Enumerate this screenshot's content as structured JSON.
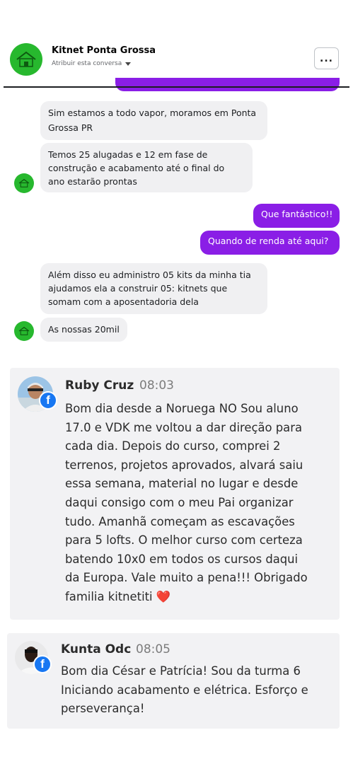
{
  "header": {
    "page_name": "Kitnet Ponta Grossa",
    "assign_label": "Atribuir esta conversa",
    "more_label": "..."
  },
  "chat": {
    "messages": [
      {
        "from": "page",
        "lines": [
          "Sim estamos a todo vapor, moramos em Ponta",
          "Grossa PR"
        ]
      },
      {
        "from": "page",
        "lines": [
          "Temos 25 alugadas e 12 em fase de",
          "construção e acabamento até o final do",
          "ano estarão prontas"
        ]
      },
      {
        "from": "user",
        "text": "Que fantástico!!"
      },
      {
        "from": "user",
        "text": "Quando de renda até aqui?"
      },
      {
        "from": "page",
        "lines": [
          "Além disso eu administro 05 kits da minha tia",
          "ajudamos ela a construir 05: kitnets que",
          "somam com a aposentadoria dela"
        ]
      },
      {
        "from": "page",
        "lines": [
          "As nossas 20mil"
        ]
      }
    ]
  },
  "comments": [
    {
      "name": "Ruby Cruz",
      "time": "08:03",
      "lines": [
        "Bom dia desde a Noruega NO Sou aluno",
        "17.0 e VDK me voltou a dar direção para",
        "cada dia. Depois do curso, comprei 2",
        "terrenos, projetos aprovados, alvará saiu",
        "essa semana, material no lugar e desde",
        "daqui consigo com o meu Pai organizar",
        "tudo. Amanhã começam as escavações",
        "para 5 lofts. O melhor curso com certeza",
        "batendo 10x0 em todos os cursos daqui",
        "da Europa. Vale muito a pena!!! Obrigado",
        "familia kitnetiti ❤️"
      ]
    },
    {
      "name": "Kunta Odc",
      "time": "08:05",
      "lines": [
        "Bom dia César e Patrícia! Sou da turma 6",
        "Iniciando acabamento e elétrica. Esforço e",
        "perseverança!"
      ]
    }
  ],
  "colors": {
    "accent_purple": "#8a1ee6",
    "avatar_green": "#27b82e",
    "facebook_blue": "#1877f2",
    "card_bg": "#f2f2f4"
  },
  "icons": {
    "facebook": "facebook-icon",
    "more": "more-icon",
    "caret": "chevron-down-icon",
    "heart": "heart-emoji"
  }
}
